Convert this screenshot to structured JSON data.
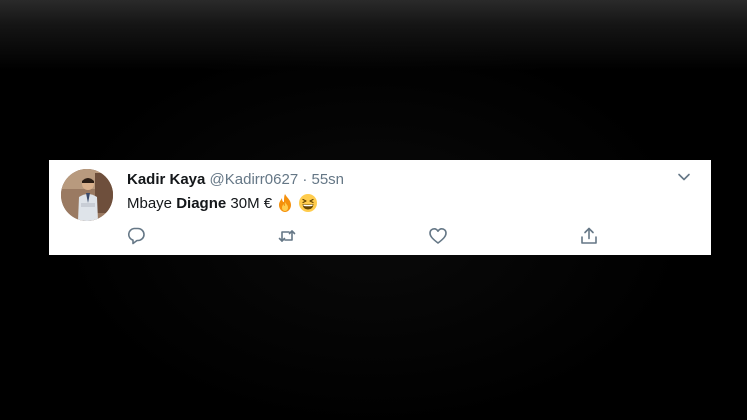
{
  "tweet": {
    "display_name": "Kadir Kaya",
    "handle": "@Kadirr0627",
    "separator": "·",
    "timestamp": "55sn",
    "text_part1": "Mbaye",
    "text_bold": "Diagne",
    "text_part2": "30M €",
    "emojis": [
      "fire-emoji",
      "grinning-squinting-face-emoji"
    ]
  },
  "icons": {
    "menu": "chevron-down-icon",
    "reply": "reply-icon",
    "retweet": "retweet-icon",
    "like": "heart-icon",
    "share": "share-icon"
  },
  "colors": {
    "text": "#14171a",
    "muted": "#657786",
    "icon": "#657786",
    "card_bg": "#ffffff",
    "page_bg": "#000000"
  }
}
